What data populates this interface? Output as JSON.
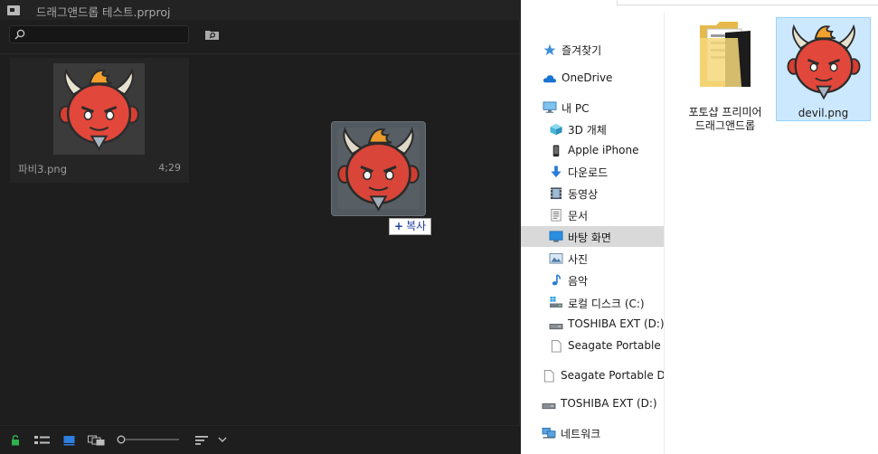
{
  "premiere": {
    "title": "드래그앤드롭 테스트.prproj",
    "search": {
      "value": "",
      "placeholder": ""
    },
    "clip": {
      "name": "파비3.png",
      "duration": "4;29"
    },
    "drag_tooltip": {
      "prefix": "+",
      "label": "복사"
    },
    "bottom_icons": [
      "lock-icon",
      "list-view-icon",
      "icon-view-icon",
      "freeform-view-icon",
      "zoom-slider",
      "sort-icon",
      "chevron-down-icon"
    ]
  },
  "explorer": {
    "nav": [
      {
        "label": "즐겨찾기",
        "icon": "star-icon"
      },
      {
        "label": "OneDrive",
        "icon": "cloud-icon"
      },
      {
        "label": "내 PC",
        "icon": "pc-icon"
      },
      {
        "label": "3D 개체",
        "icon": "cube-icon"
      },
      {
        "label": "Apple iPhone",
        "icon": "phone-icon"
      },
      {
        "label": "다운로드",
        "icon": "download-icon"
      },
      {
        "label": "동영상",
        "icon": "film-icon"
      },
      {
        "label": "문서",
        "icon": "document-icon"
      },
      {
        "label": "바탕 화면",
        "icon": "desktop-icon",
        "selected": true
      },
      {
        "label": "사진",
        "icon": "picture-icon"
      },
      {
        "label": "음악",
        "icon": "music-icon"
      },
      {
        "label": "로컬 디스크 (C:)",
        "icon": "disk-icon"
      },
      {
        "label": "TOSHIBA EXT (D:)",
        "icon": "drive-icon"
      },
      {
        "label": "Seagate Portable Drive",
        "icon": "blank-doc-icon"
      },
      {
        "label": "Seagate Portable Drive",
        "icon": "blank-doc-icon"
      },
      {
        "label": "TOSHIBA EXT (D:)",
        "icon": "drive-icon"
      },
      {
        "label": "네트워크",
        "icon": "network-icon"
      }
    ],
    "files": [
      {
        "label_line1": "포토샵 프리미어",
        "label_line2": "드래그앤드롭",
        "icon": "folder-icon"
      },
      {
        "label_line1": "devil.png",
        "icon": "image-file-icon",
        "selected": true
      }
    ]
  },
  "colors": {
    "premiere_bg": "#1e1e1e",
    "selection_blue": "#cce8ff",
    "tooltip_text": "#1f3f9f",
    "nav_selected": "#d9d9d9"
  }
}
